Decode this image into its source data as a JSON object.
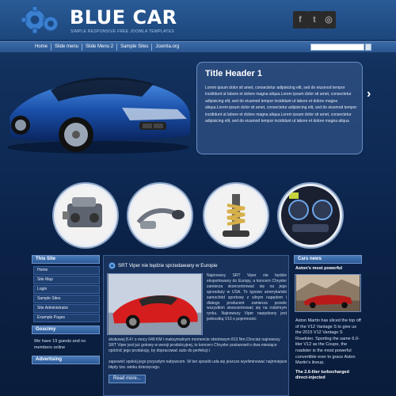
{
  "header": {
    "brand": "BLUE CAR",
    "tagline": "SIMPLE RESPONSIVE FREE JOOMLA TEMPLATES",
    "social": [
      {
        "icon": "facebook-icon",
        "glyph": "f"
      },
      {
        "icon": "twitter-icon",
        "glyph": "t"
      },
      {
        "icon": "instagram-icon",
        "glyph": "◎"
      }
    ]
  },
  "nav": {
    "items": [
      "Home",
      "Slide menu",
      "Slide Menu 2",
      "Sample Sites",
      "Joomla.org"
    ],
    "search_placeholder": ""
  },
  "slide": {
    "title": "Title Header 1",
    "text": "Lorem ipsum dolor sit amet, consectetur adipisicing elit, sed do eiusmod tempor incididunt ut labore et dolore magna aliqua.Lorem ipsum dolor sit amet, consectetur adipisicing elit, sed do eiusmod tempor incididunt ut labore et dolore magna aliqua.Lorem ipsum dolor sit amet, consectetur adipisicing elit, sed do eiusmod tempor incididunt ut labore et dolore magna aliqua.Lorem ipsum dolor sit amet, consectetur adipisicing elit, sed do eiusmod tempor incididunt ut labore et dolore magna aliqua"
  },
  "left": {
    "this_site": {
      "title": "This Site",
      "items": [
        "Home",
        "Site Map",
        "Login",
        "Sample Sites",
        "Site Administrator",
        "Example Pages"
      ]
    },
    "who": {
      "title": "Goscimy",
      "text": "We have 19 guests and no members online"
    },
    "advertising": {
      "title": "Advertising"
    }
  },
  "article": {
    "title": "SRT Viper nie będzie sprzedawany w Europie",
    "text_right": "Najnowszy SRT Viper nie będzie eksportowany do Europy, a koncern Chrysler zamierza skoncentrować się na jego sprzedaży w USA. To typowo amerykański samochód sportowy z silnym napędem i dlatego producent zamierza przede wszystkim skoncentrować się na rodzimym rynku. Najnowszy Viper napędzany jest jednostką V10 o pojemności",
    "text_bottom": "skokowej 8.4 l o mocy 649 KM i maksymalnym momencie obrotowym 813 Nm.Chociaż najnowszy SRT Viper jest już gotowy w wersji produkcyjnej, to koncern Chrysler postanowił o dwa miesiące opóźnić jego produkcję, by dopracować auto do perfekcji i",
    "text_2": "zapewnić spokój jego przyszłym nabywcom. W ten sposób uda się jeszcze wyeliminować najmniejsze błędy tzw. wieku dziecięcego.",
    "read_more": "Read more..."
  },
  "right": {
    "title": "Cars news",
    "news_title": "Aston's most powerful",
    "news_text": "Aston Martin has sliced the top off of the V12 Vantage S to give us the 2015 V12 Vantage S Roadster. Sporting the same 6.0-liter V12 as the Coupe, the roadster is the most powerful convertible ever to grace Aston Martin's lineup.",
    "news_title2": "The 2.6-liter turbocharged direct-injected"
  },
  "colors": {
    "accent": "#2c5a98",
    "header": "#1c467c",
    "background": "#0b2247"
  }
}
